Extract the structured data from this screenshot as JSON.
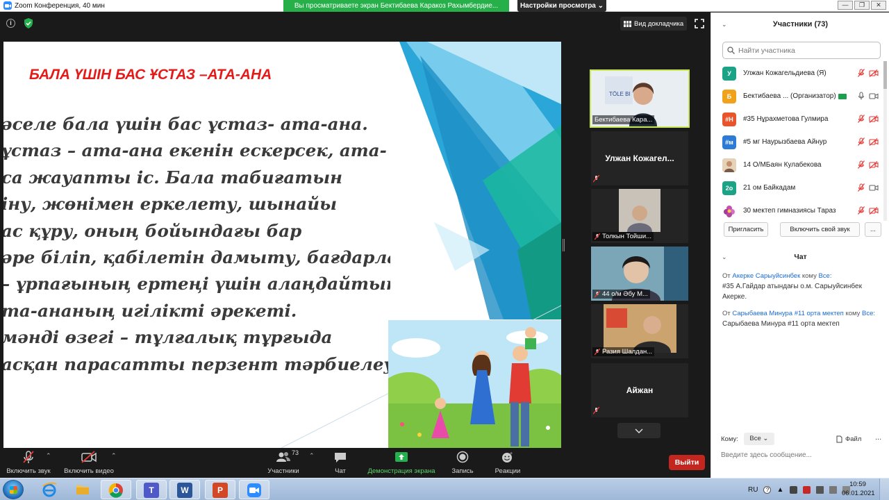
{
  "window": {
    "title": "Zoom Конференция, 40 мин",
    "viewing_banner": "Вы просматриваете экран Бектибаева Каракоз Рахымбердие...",
    "view_settings": "Настройки просмотра",
    "controls": [
      "—",
      "❐",
      "✕"
    ]
  },
  "meeting": {
    "speaker_view_label": "Вид докладчика"
  },
  "slide": {
    "title": "БАЛА ҮШІН БАС ҰСТАЗ –АТА-АНА",
    "lines": [
      "әселе бала үшін бас ұстаз- ата-ана.",
      "ұстаз – ата-ана  екенін ескерсек, ата-",
      "са жауапты іс. Бала табиғатын",
      "іну, жөнімен еркелету, шынайы",
      "ас құру, оның бойындағы бар",
      "әре біліп, қабілетін дамыту, бағдарлау,",
      "– ұрпағының ертеңі үшін алаңдайтын",
      "та-ананың игілікті әрекеті.",
      " мәнді өзегі – тұлғалық тұрғыда",
      "асқан парасатты перзент тәрбиелеу."
    ]
  },
  "tiles": [
    {
      "name": "Бектибаева Кара...",
      "type": "video"
    },
    {
      "name": "Улжан  Кожагел...",
      "type": "name"
    },
    {
      "name": "Толкын Тойши...",
      "type": "video"
    },
    {
      "name": "44 о/м Әбу М...",
      "type": "video"
    },
    {
      "name": "Разия Шалдан...",
      "type": "video"
    },
    {
      "name": "Айжан",
      "type": "name"
    }
  ],
  "toolbar": {
    "unmute": "Включить звук",
    "start_video": "Включить видео",
    "participants": "Участники",
    "participants_count": "73",
    "chat": "Чат",
    "share": "Демонстрация экрана",
    "record": "Запись",
    "reactions": "Реакции",
    "leave": "Выйти"
  },
  "participants_panel": {
    "title": "Участники (73)",
    "search_placeholder": "Найти участника",
    "items": [
      {
        "initial": "У",
        "color": "#1aa385",
        "name": "Улжан Кожагельдиева (Я)",
        "mic": "off",
        "video": "off"
      },
      {
        "initial": "Б",
        "color": "#f0a21b",
        "name": "Бектибаева ... (Организатор)",
        "mic": "on",
        "video": "on"
      },
      {
        "initial": "#Н",
        "color": "#e8542b",
        "name": "#35 Нұрахметова Гулмира",
        "mic": "off",
        "video": "off"
      },
      {
        "initial": "#м",
        "color": "#2d7bd6",
        "name": "#5 мг Наурызбаева Айнур",
        "mic": "off",
        "video": "off"
      },
      {
        "initial": "",
        "color": "#c9a27c",
        "name": "14 О/МБаян Кулабекова",
        "mic": "off",
        "video": "off"
      },
      {
        "initial": "2о",
        "color": "#1aa385",
        "name": "21 ом Байкадам",
        "mic": "off",
        "video": "on"
      },
      {
        "initial": "",
        "color": "#c84fb0",
        "name": "30 мектеп гимназиясы Тараз",
        "mic": "off",
        "video": "off"
      }
    ],
    "invite": "Пригласить",
    "unmute_me": "Включить свой звук",
    "more": "..."
  },
  "chat_panel": {
    "title": "Чат",
    "messages": [
      {
        "from_prefix": "От",
        "sender": "Акерке Сарыуйсинбек",
        "to_prefix": "кому",
        "to": "Все:",
        "text": "#35 А.Гайдар атындағы о.м. Сарыуйсинбек Акерке."
      },
      {
        "from_prefix": "От",
        "sender": "Сарыбаева Минура #11 орта мектеп",
        "to_prefix": "кому",
        "to": "Все:",
        "text": "Сарыбаева Минура #11 орта мектеп"
      }
    ],
    "to_label": "Кому:",
    "to_value": "Все",
    "file_label": "Файл",
    "more": "...",
    "input_placeholder": "Введите здесь сообщение..."
  },
  "taskbar": {
    "lang": "RU",
    "time": "10:59",
    "date": "06.01.2021"
  }
}
